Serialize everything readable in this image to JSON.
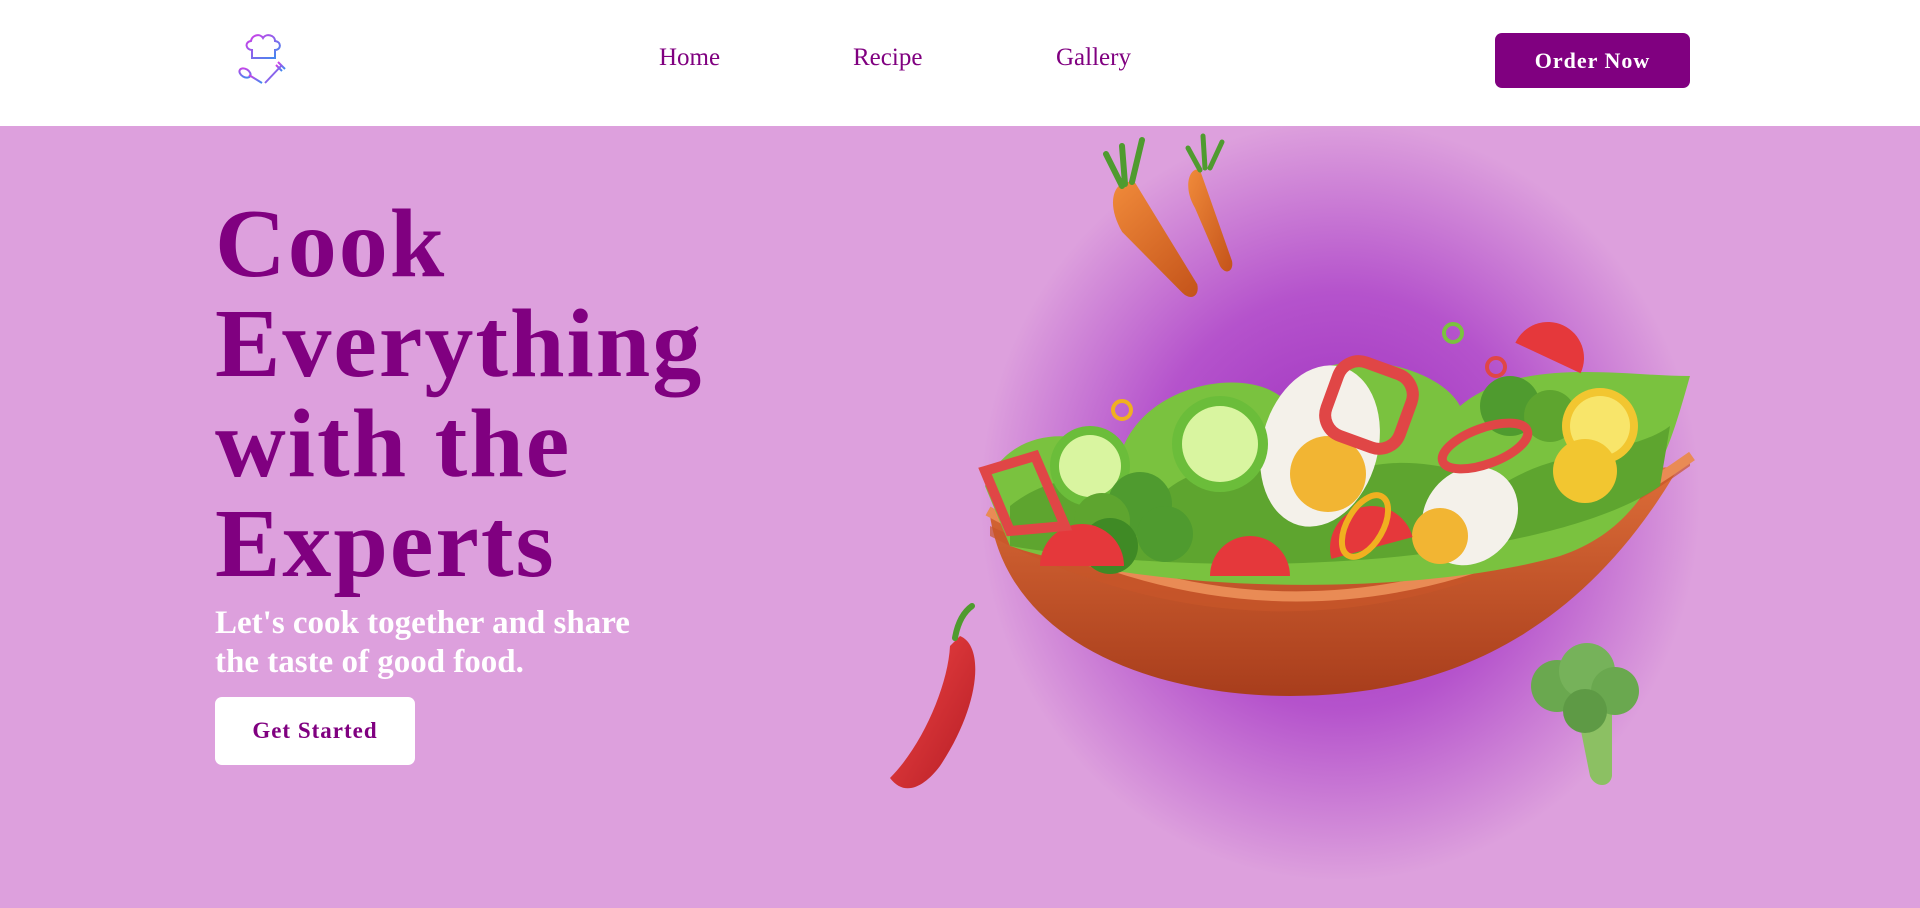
{
  "header": {
    "logo_icon": "chef-hat-utensils-icon",
    "nav": [
      {
        "label": "Home"
      },
      {
        "label": "Recipe"
      },
      {
        "label": "Gallery"
      }
    ],
    "order_button": "Order Now"
  },
  "hero": {
    "title_lines": [
      "Cook",
      "Everything",
      "with the",
      "Experts"
    ],
    "subtitle_lines": [
      "Let's cook together and share",
      "the taste of good food."
    ],
    "cta": "Get Started"
  },
  "illustration": {
    "items": [
      "carrots",
      "salad-bowl",
      "chili-pepper",
      "broccoli"
    ]
  },
  "colors": {
    "brand": "#800080",
    "hero_bg": "#dda0dd",
    "header_bg": "#ffffff"
  }
}
